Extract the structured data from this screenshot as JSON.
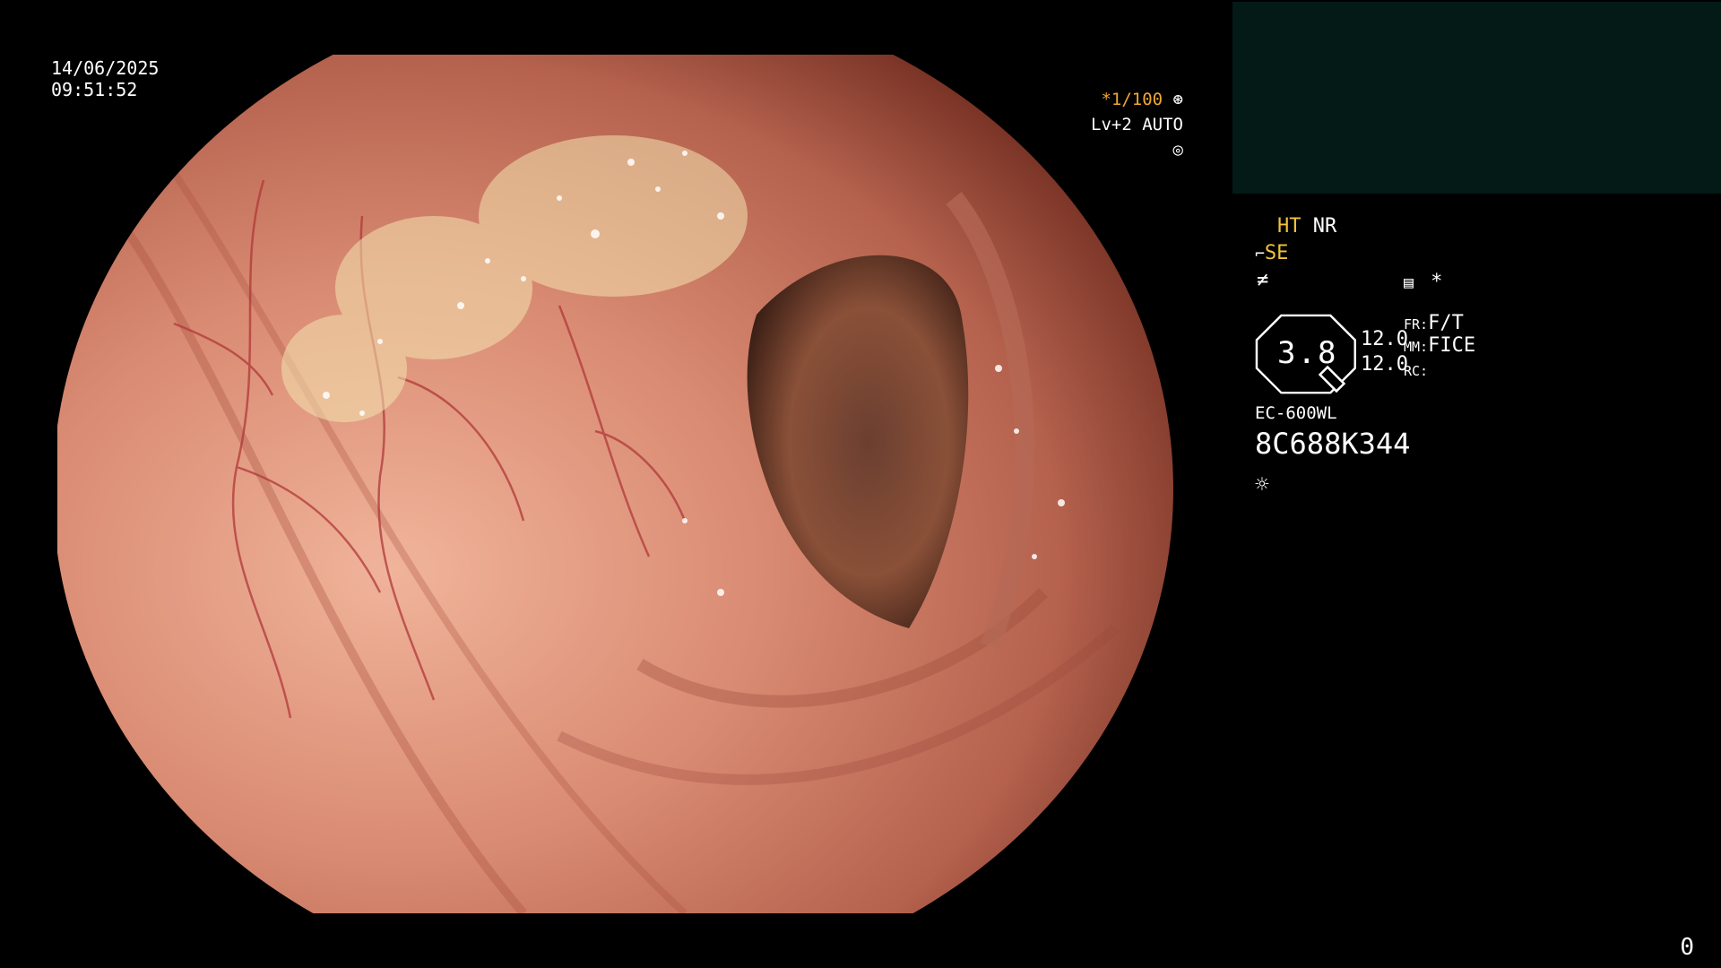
{
  "overlay": {
    "date": "14/06/2025",
    "time": "09:51:52",
    "shutter_speed": "*1/100",
    "shutter_icon": "aperture-icon",
    "light_level": "Lv+2 AUTO",
    "light_icon": "iris-icon"
  },
  "settings": {
    "ht": "HT",
    "nr": "NR",
    "se": "SE",
    "se_icon": "scope-tip-icon",
    "filter_icon": "filter-off-icon",
    "memo_icon": "document-list-icon",
    "asterisk": "*",
    "gauge_value": "3.8",
    "gauge_icon": "zoom-gauge-icon",
    "value_1": "12.0",
    "value_2": "12.0",
    "fr_label": "FR:",
    "fr_value": "F/T",
    "mm_label": "MM:",
    "mm_value": "FICE",
    "rc_label": "RC:",
    "rc_value": "",
    "scope_model": "EC-600WL",
    "serial": "8C688K344",
    "light_source_icon": "sun-icon"
  },
  "colors": {
    "highlight": "#f2c23a",
    "shutter_text": "#f0a830",
    "thumbnail_bg": "#031a17"
  },
  "corner_counter": "0"
}
